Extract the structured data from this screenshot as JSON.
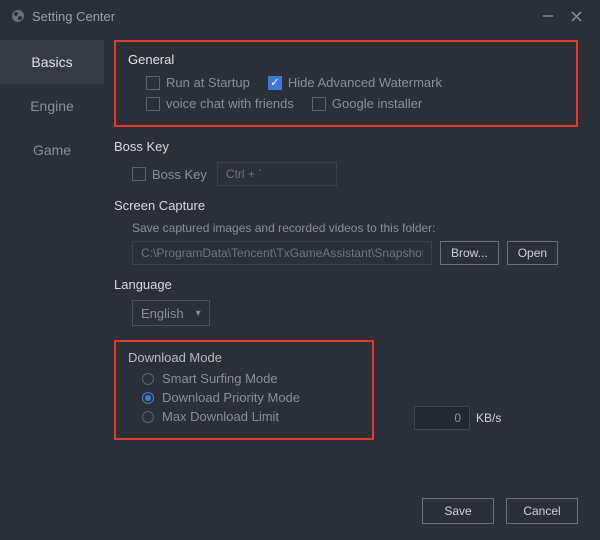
{
  "window": {
    "title": "Setting Center"
  },
  "sidebar": {
    "items": [
      {
        "label": "Basics"
      },
      {
        "label": "Engine"
      },
      {
        "label": "Game"
      }
    ],
    "activeIndex": 0
  },
  "general": {
    "title": "General",
    "run_at_startup": {
      "label": "Run at Startup",
      "checked": false
    },
    "hide_watermark": {
      "label": "Hide Advanced Watermark",
      "checked": true
    },
    "voice_chat": {
      "label": "voice chat with friends",
      "checked": false
    },
    "google_installer": {
      "label": "Google installer",
      "checked": false
    }
  },
  "bosskey": {
    "title": "Boss Key",
    "checkbox_label": "Boss Key",
    "checked": false,
    "shortcut": "Ctrl + `"
  },
  "capture": {
    "title": "Screen Capture",
    "caption": "Save captured images and recorded videos to this folder:",
    "path": "C:\\ProgramData\\Tencent\\TxGameAssistant\\Snapshot",
    "browse_label": "Brow...",
    "open_label": "Open"
  },
  "language": {
    "title": "Language",
    "selected": "English"
  },
  "download": {
    "title": "Download Mode",
    "options": [
      {
        "label": "Smart Surfing Mode"
      },
      {
        "label": "Download Priority Mode"
      },
      {
        "label": "Max Download Limit"
      }
    ],
    "selectedIndex": 1,
    "limit_value": "0",
    "limit_unit": "KB/s"
  },
  "footer": {
    "save": "Save",
    "cancel": "Cancel"
  }
}
